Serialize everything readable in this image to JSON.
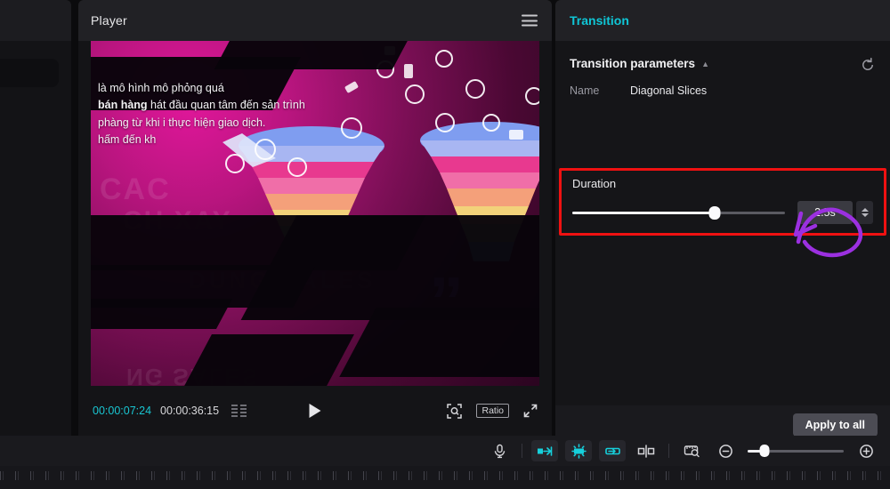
{
  "left_panel": {
    "name": "media-panel-stub"
  },
  "player": {
    "title": "Player",
    "menu_icon": "hamburger-icon",
    "current_time": "00:00:07:24",
    "total_time": "00:00:36:15",
    "grid_icon": "storyboard-icon",
    "play_icon": "play-icon",
    "zoom_frame_icon": "zoom-to-fit-icon",
    "ratio_label": "Ratio",
    "fullscreen_icon": "fullscreen-icon",
    "caption": {
      "line1": "là mô hình mô phỏng quá",
      "line2_bold": "bán hàng",
      "line2": "hát đầu quan tâm đến sản",
      "line2_tail": "trình",
      "line3": "phàng từ khi      i thực hiện giao dịch.",
      "line4": "hấm đến kh"
    },
    "ghost_text": {
      "g1": "CAC",
      "g2": "CH XAY",
      "g3": "DUNG SALES",
      "g4": "NG SALES"
    }
  },
  "transition": {
    "header": "Transition",
    "parameters_label": "Transition parameters",
    "collapse_icon": "chevron-up-icon",
    "reset_icon": "reset-icon",
    "name_key": "Name",
    "name_value": "Diagonal Slices",
    "duration_label": "Duration",
    "duration_value": "2.5s",
    "duration_percent": 67,
    "spinner_icon": "stepper-icon",
    "apply_button": "Apply to all",
    "accent_color": "#0fc6d6",
    "highlight_color": "#ef1111",
    "annotation_color": "#9b30e0"
  },
  "toolbar": {
    "mic_icon": "microphone-icon",
    "items": [
      {
        "icon": "split-left-icon",
        "active": true
      },
      {
        "icon": "freeze-frame-icon",
        "active": true
      },
      {
        "icon": "split-right-icon",
        "active": true
      },
      {
        "icon": "cut-clip-icon",
        "active": false
      },
      {
        "icon": "snapshot-icon",
        "active": false
      }
    ],
    "zoom_out_icon": "zoom-out-icon",
    "zoom_in_icon": "zoom-in-icon",
    "zoom_percent": 18
  }
}
